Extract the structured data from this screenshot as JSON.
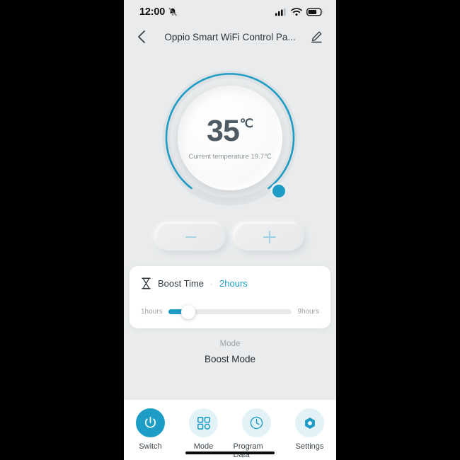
{
  "status_bar": {
    "time": "12:00",
    "icons": [
      "bell-off-icon",
      "cellular-signal-icon",
      "wifi-icon",
      "battery-icon"
    ]
  },
  "header": {
    "title": "Oppio Smart WiFi Control Pa...",
    "back_icon": "chevron-left-icon",
    "edit_icon": "pencil-edit-icon"
  },
  "dial": {
    "set_temperature": "35",
    "unit": "℃",
    "current_temperature_text": "Current temperature 19.7℃",
    "arc_color": "#1d9cc5",
    "track_color": "#e2e4e6",
    "knob_color": "#1d9cc5"
  },
  "adjust": {
    "decrease_label": "−",
    "increase_label": "+",
    "decrease_icon": "minus-icon",
    "increase_icon": "plus-icon"
  },
  "boost": {
    "icon": "hourglass-icon",
    "label": "Boost Time",
    "separator": "·",
    "value": "2hours",
    "slider": {
      "min_label": "1hours",
      "max_label": "9hours",
      "min": 1,
      "max": 9,
      "value": 2,
      "fill_color": "#1d9cc5"
    }
  },
  "mode": {
    "label": "Mode",
    "value": "Boost Mode"
  },
  "bottom_nav": {
    "items": [
      {
        "label": "Switch",
        "icon": "power-icon",
        "active": true
      },
      {
        "label": "Mode",
        "icon": "grid-apps-icon",
        "active": false
      },
      {
        "label": "Program Data",
        "icon": "clock-icon",
        "active": false
      },
      {
        "label": "Settings",
        "icon": "hexagon-gear-icon",
        "active": false
      }
    ],
    "active_color": "#1d9cc5",
    "inactive_bg": "#e3f2f7"
  }
}
